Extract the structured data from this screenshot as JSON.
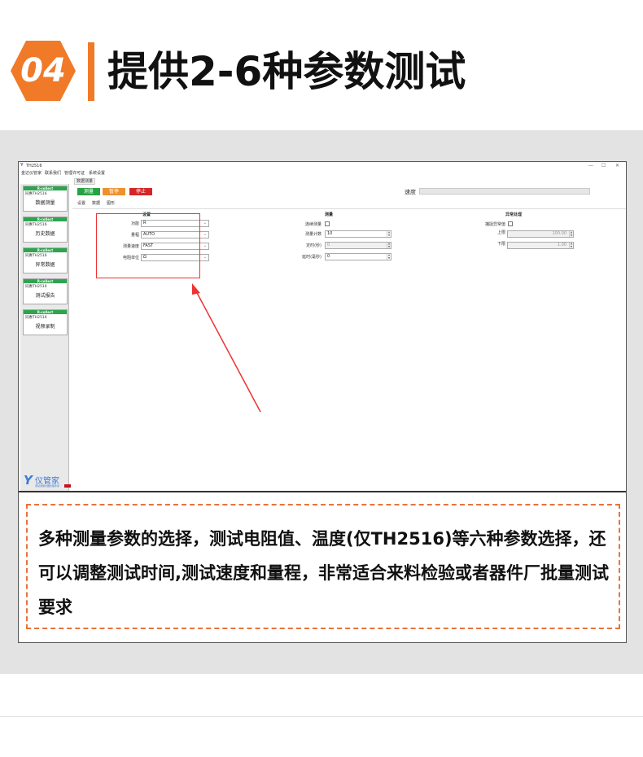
{
  "header": {
    "number": "04",
    "title": "提供2-6种参数测试",
    "accent": "#f07a28"
  },
  "window": {
    "title": "TH2516",
    "controls": [
      "—",
      "☐",
      "✕"
    ],
    "menu": [
      "金达仪管家",
      "联系我们",
      "管理许可证",
      "系统设置"
    ],
    "tab_top": "数据测量"
  },
  "sidebar": {
    "cards": [
      {
        "header": "R-collect",
        "sub": "同惠TH2516",
        "label": "数据测量"
      },
      {
        "header": "R-collect",
        "sub": "同惠TH2516",
        "label": "历史数据"
      },
      {
        "header": "R-collect",
        "sub": "同惠TH2516",
        "label": "异常数据"
      },
      {
        "header": "R-collect",
        "sub": "同惠TH2516",
        "label": "测试报告"
      },
      {
        "header": "R-collect",
        "sub": "同惠TH2516",
        "label": "视频录制"
      }
    ],
    "logo_mark": "Y",
    "logo_text": "仪管家",
    "logo_sub": "测试测量仪器管理专家"
  },
  "toolbar": {
    "measure_label": "测量",
    "pause_label": "暂停",
    "stop_label": "停止",
    "measure_color": "#25a244",
    "pause_color": "#f0902c",
    "stop_color": "#d42626",
    "speed_label": "速度"
  },
  "tabs": [
    "设置",
    "数据",
    "图形"
  ],
  "settings": {
    "title": "设置",
    "fields": [
      {
        "label": "功能",
        "value": "R"
      },
      {
        "label": "量程",
        "value": "AUTO"
      },
      {
        "label": "测量速度",
        "value": "FAST"
      },
      {
        "label": "电阻单位",
        "value": "Ω"
      }
    ]
  },
  "measure": {
    "title": "测量",
    "continuous_label": "连续测量",
    "count_label": "测量计数",
    "count_value": "10",
    "timed_label": "定时(秒)",
    "timed_value": "0",
    "delay_label": "延时(毫秒)",
    "delay_value": "0"
  },
  "abnormal": {
    "title": "异常处理",
    "catch_label": "捕捉异常值",
    "upper_label": "上限",
    "upper_value": "100.00",
    "lower_label": "下限",
    "lower_value": "1.00"
  },
  "description": {
    "text": "多种测量参数的选择，测试电阻值、温度(仅TH2516)等六种参数选择，还可以调整测试时间,测试速度和量程，非常适合来料检验或者器件厂批量测试要求"
  }
}
